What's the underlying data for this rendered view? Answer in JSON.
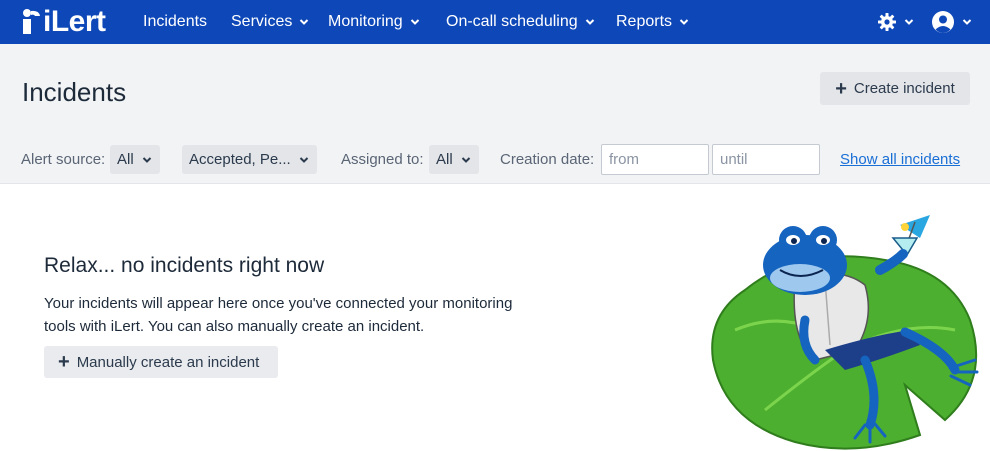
{
  "nav": {
    "logo_text": "iLert",
    "items": [
      {
        "label": "Incidents",
        "has_dropdown": false
      },
      {
        "label": "Services",
        "has_dropdown": true
      },
      {
        "label": "Monitoring",
        "has_dropdown": true
      },
      {
        "label": "On-call scheduling",
        "has_dropdown": true
      },
      {
        "label": "Reports",
        "has_dropdown": true
      }
    ],
    "right_icons": [
      "gear-icon",
      "user-avatar-icon"
    ],
    "bg_color": "#0d47b8"
  },
  "header": {
    "title": "Incidents",
    "create_button": "Create incident"
  },
  "filters": {
    "alert_source_label": "Alert source:",
    "alert_source_value": "All",
    "status_value": "Accepted, Pe...",
    "assigned_label": "Assigned to:",
    "assigned_value": "All",
    "creation_date_label": "Creation date:",
    "from_placeholder": "from",
    "until_placeholder": "until",
    "show_all_link": "Show all incidents"
  },
  "empty_state": {
    "title": "Relax... no incidents right now",
    "text": "Your incidents will appear here once you've connected your monitoring tools with iLert. You can also manually create an incident.",
    "button": "Manually create an incident",
    "illustration": "relaxing-frog-on-lily-pad"
  }
}
